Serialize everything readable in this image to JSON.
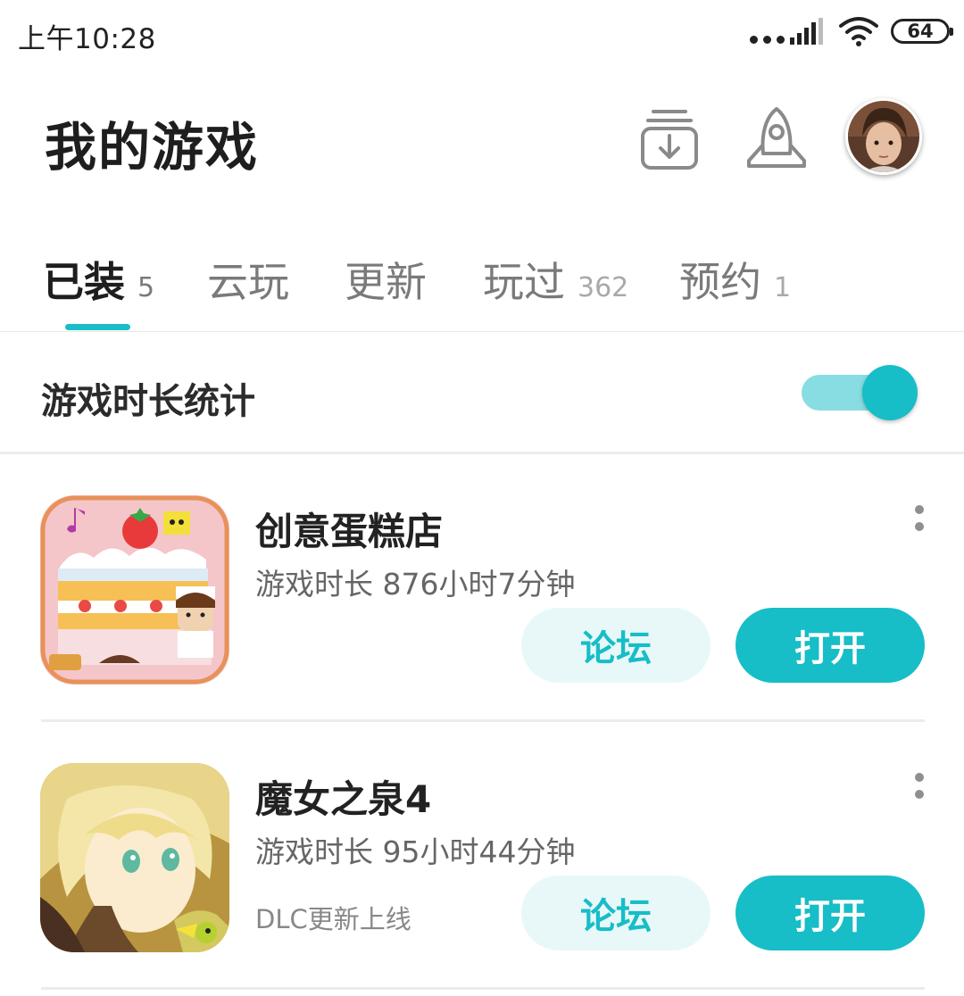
{
  "status_bar": {
    "time": "上午10:28",
    "battery": "64"
  },
  "header": {
    "title": "我的游戏",
    "icons": [
      "download-icon",
      "rocket-icon"
    ],
    "avatar": "user-avatar"
  },
  "tabs": [
    {
      "label": "已装",
      "count": "5",
      "active": true
    },
    {
      "label": "云玩",
      "count": ""
    },
    {
      "label": "更新",
      "count": ""
    },
    {
      "label": "玩过",
      "count": "362"
    },
    {
      "label": "预约",
      "count": "1"
    }
  ],
  "stats": {
    "label": "游戏时长统计",
    "toggle_on": true
  },
  "games": [
    {
      "title": "创意蛋糕店",
      "playtime": "游戏时长 876小时7分钟",
      "note": "",
      "forum_label": "论坛",
      "open_label": "打开"
    },
    {
      "title": "魔女之泉4",
      "playtime": "游戏时长 95小时44分钟",
      "note": "DLC更新上线",
      "forum_label": "论坛",
      "open_label": "打开"
    }
  ],
  "colors": {
    "accent": "#17bdc7",
    "accent_light": "#e8f8f9",
    "toggle_track": "#88dde3"
  }
}
